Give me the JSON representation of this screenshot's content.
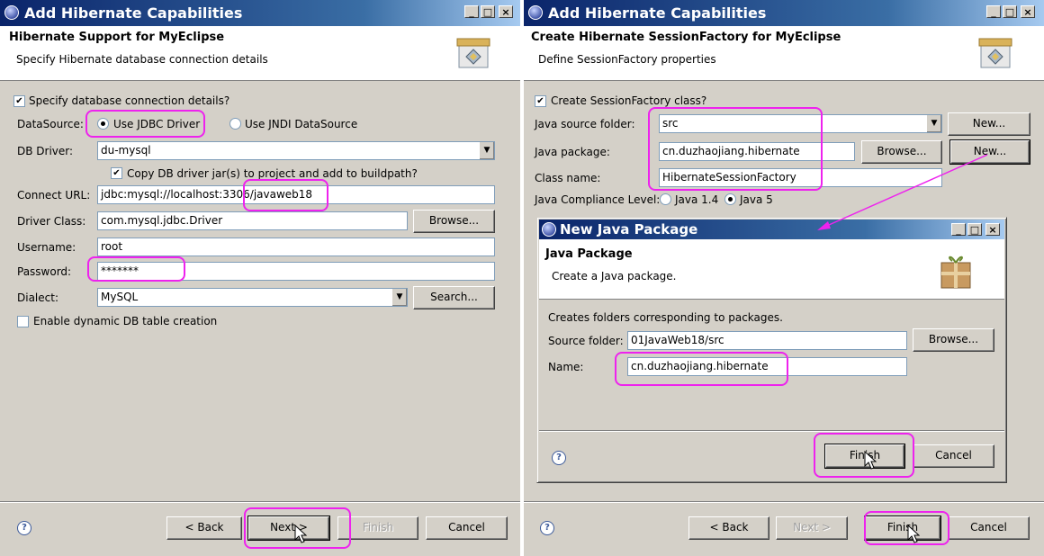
{
  "left_window": {
    "title": "Add Hibernate Capabilities",
    "banner_title": "Hibernate Support for MyEclipse",
    "banner_subtitle": "Specify Hibernate database connection details",
    "specify_checkbox_label": "Specify database connection details?",
    "datasource_label": "DataSource:",
    "jdbc_option": "Use JDBC Driver",
    "jndi_option": "Use JNDI DataSource",
    "db_driver_label": "DB Driver:",
    "db_driver_value": "du-mysql",
    "copy_jar_label": "Copy DB driver jar(s) to project and add to buildpath?",
    "connect_url_label": "Connect URL:",
    "connect_url_value": "jdbc:mysql://localhost:3306/javaweb18",
    "driver_class_label": "Driver Class:",
    "driver_class_value": "com.mysql.jdbc.Driver",
    "browse_label": "Browse...",
    "username_label": "Username:",
    "username_value": "root",
    "password_label": "Password:",
    "password_value": "*******",
    "dialect_label": "Dialect:",
    "dialect_value": "MySQL",
    "search_label": "Search...",
    "dynamic_table_label": "Enable dynamic DB table creation",
    "back_label": "< Back",
    "next_label": "Next >",
    "finish_label": "Finish",
    "cancel_label": "Cancel"
  },
  "right_window": {
    "title": "Add Hibernate Capabilities",
    "banner_title": "Create Hibernate SessionFactory for MyEclipse",
    "banner_subtitle": "Define SessionFactory properties",
    "create_class_label": "Create SessionFactory class?",
    "source_folder_label": "Java source folder:",
    "source_folder_value": "src",
    "new_label": "New...",
    "package_label": "Java package:",
    "package_value": "cn.duzhaojiang.hibernate",
    "browse_label": "Browse...",
    "new2_label": "New...",
    "class_name_label": "Class name:",
    "class_name_value": "HibernateSessionFactory",
    "compliance_label": "Java Compliance Level:",
    "java14_label": "Java 1.4",
    "java5_label": "Java 5",
    "back_label": "< Back",
    "next_label": "Next >",
    "finish_label": "Finish",
    "cancel_label": "Cancel"
  },
  "package_dialog": {
    "title": "New Java Package",
    "banner_title": "Java Package",
    "banner_subtitle": "Create a Java package.",
    "description": "Creates folders corresponding to packages.",
    "source_folder_label": "Source folder:",
    "source_folder_value": "01JavaWeb18/src",
    "browse_label": "Browse...",
    "name_label": "Name:",
    "name_value": "cn.duzhaojiang.hibernate",
    "finish_label": "Finish",
    "cancel_label": "Cancel"
  },
  "colors": {
    "highlight": "#ee22ee",
    "title_bar": "#0a246a"
  }
}
